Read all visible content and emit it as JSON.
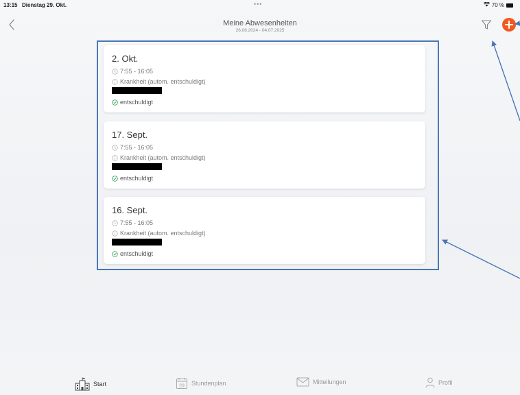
{
  "status_bar": {
    "time": "13:15",
    "date": "Dienstag 29. Okt.",
    "multitask_dots": "•••",
    "wifi_icon": "wifi-icon",
    "battery": "70 %"
  },
  "header": {
    "back_icon": "chevron-left-icon",
    "title": "Meine Abwesenheiten",
    "subtitle": "26.08.2024 - 04.07.2025",
    "filter_icon": "filter-icon",
    "add_icon": "plus-circle-icon"
  },
  "absences": [
    {
      "date": "2. Okt.",
      "time": "7:55 - 16:05",
      "reason": "Krankheit (autom. entschuldigt)",
      "status": "entschuldigt"
    },
    {
      "date": "17. Sept.",
      "time": "7:55 - 16:05",
      "reason": "Krankheit (autom. entschuldigt)",
      "status": "entschuldigt"
    },
    {
      "date": "16. Sept.",
      "time": "7:55 - 16:05",
      "reason": "Krankheit (autom. entschuldigt)",
      "status": "entschuldigt"
    }
  ],
  "tab_bar": {
    "items": [
      {
        "label": "Start",
        "icon": "school-icon",
        "active": true
      },
      {
        "label": "Stundenplan",
        "icon": "calendar-icon",
        "calendar_day": "29",
        "active": false
      },
      {
        "label": "Mitteilungen",
        "icon": "mail-icon",
        "active": false
      },
      {
        "label": "Profil",
        "icon": "person-icon",
        "active": false
      }
    ]
  },
  "colors": {
    "accent": "#f05a1e",
    "annotation": "#4a76b8",
    "status_ok": "#2e9a58"
  }
}
